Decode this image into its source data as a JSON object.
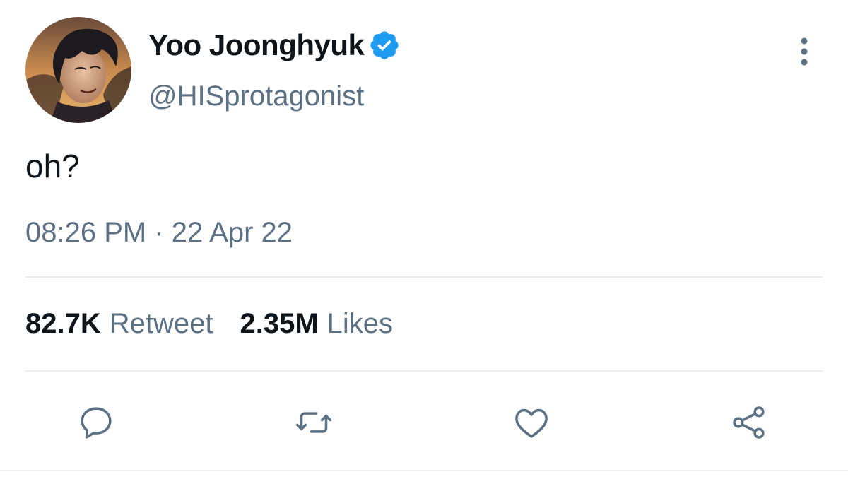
{
  "tweet": {
    "display_name": "Yoo Joonghyuk",
    "handle": "@HISprotagonist",
    "text": "oh?",
    "time": "08:26 PM",
    "separator": "·",
    "date": "22 Apr 22"
  },
  "stats": {
    "retweets_count": "82.7K",
    "retweets_label": "Retweet",
    "likes_count": "2.35M",
    "likes_label": "Likes"
  },
  "icons": {
    "verified": "verified-badge-icon",
    "more": "more-vertical-icon",
    "reply": "reply-icon",
    "retweet": "retweet-icon",
    "like": "heart-icon",
    "share": "share-icon"
  },
  "colors": {
    "text_primary": "#0f1419",
    "text_secondary": "#5b7083",
    "verified_blue": "#1d9bf0",
    "divider": "#e6ecf0"
  }
}
